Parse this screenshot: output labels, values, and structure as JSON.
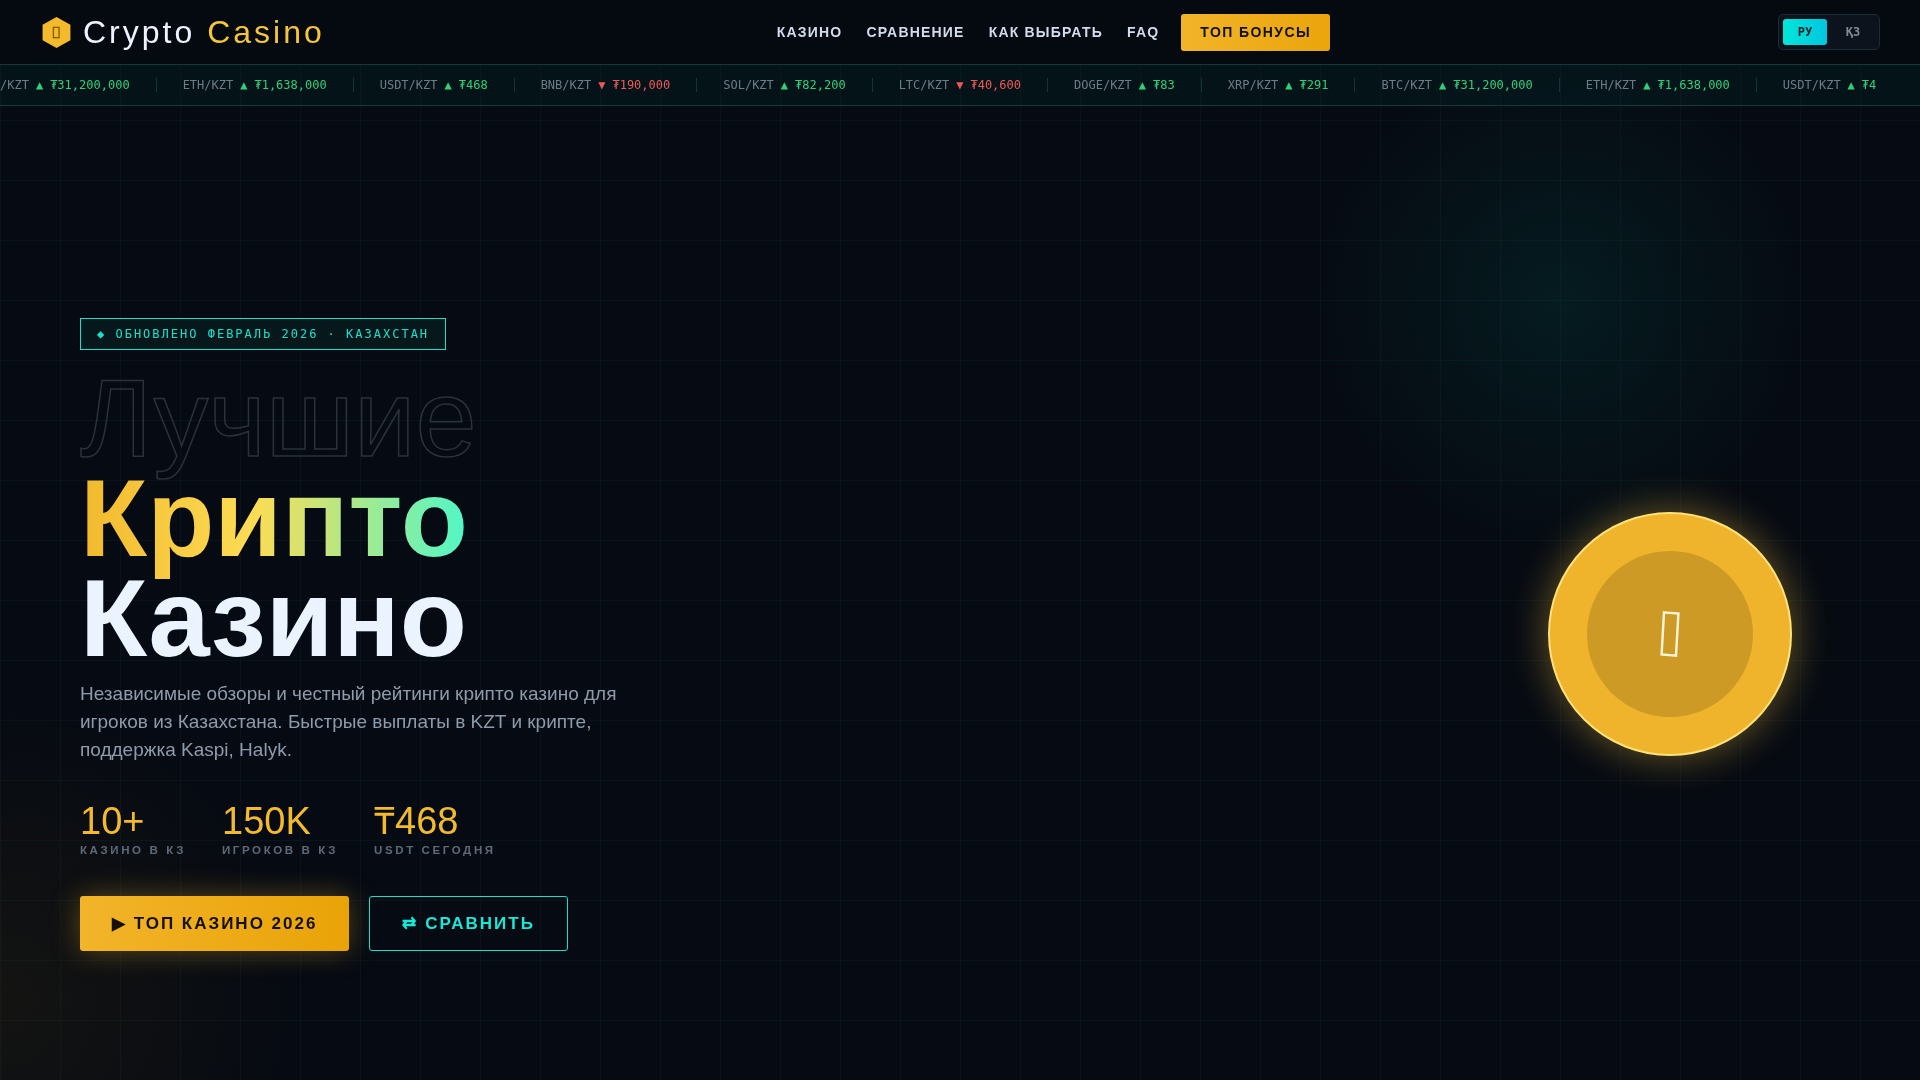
{
  "header": {
    "logo": {
      "first": "Crypto",
      "second": "Casino"
    },
    "nav": [
      {
        "label": "КАЗИНО"
      },
      {
        "label": "СРАВНЕНИЕ"
      },
      {
        "label": "КАК ВЫБРАТЬ"
      },
      {
        "label": "FAQ"
      }
    ],
    "cta": "ТОП БОНУСЫ",
    "languages": [
      {
        "label": "РУ",
        "selected": true
      },
      {
        "label": "ҚЗ",
        "selected": false
      }
    ]
  },
  "ticker": [
    {
      "pair": "/KZT",
      "arrow": "▲",
      "falling": false,
      "price": "₮31,200,000"
    },
    {
      "pair": "ETH/KZT",
      "arrow": "▲",
      "falling": false,
      "price": "₮1,638,000"
    },
    {
      "pair": "USDT/KZT",
      "arrow": "▲",
      "falling": false,
      "price": "₮468"
    },
    {
      "pair": "BNB/KZT",
      "arrow": "▼",
      "falling": true,
      "price": "₮190,000"
    },
    {
      "pair": "SOL/KZT",
      "arrow": "▲",
      "falling": false,
      "price": "₮82,200"
    },
    {
      "pair": "LTC/KZT",
      "arrow": "▼",
      "falling": true,
      "price": "₮40,600"
    },
    {
      "pair": "DOGE/KZT",
      "arrow": "▲",
      "falling": false,
      "price": "₮83"
    },
    {
      "pair": "XRP/KZT",
      "arrow": "▲",
      "falling": false,
      "price": "₮291"
    },
    {
      "pair": "BTC/KZT",
      "arrow": "▲",
      "falling": false,
      "price": "₮31,200,000"
    },
    {
      "pair": "ETH/KZT",
      "arrow": "▲",
      "falling": false,
      "price": "₮1,638,000"
    },
    {
      "pair": "USDT/KZT",
      "arrow": "▲",
      "falling": false,
      "price": "₮4"
    }
  ],
  "hero": {
    "badge": "◆ ОБНОВЛЕНО ФЕВРАЛЬ 2026 · КАЗАХСТАН",
    "title": [
      {
        "text": "Лучшие",
        "kind": "outline"
      },
      {
        "text": "Крипто",
        "kind": "gradient"
      },
      {
        "text": "Казино",
        "kind": "solid"
      }
    ],
    "description": "Независимые обзоры и честный рейтинги крипто казино для игроков из Казахстана. Быстрые выплаты в KZT и крипте, поддержка Kaspi, Halyk.",
    "stats": [
      {
        "value": "10+",
        "label": "КАЗИНО В КЗ"
      },
      {
        "value": "150K",
        "label": "ИГРОКОВ В КЗ"
      },
      {
        "value": "₸468",
        "label": "USDT СЕГОДНЯ"
      }
    ],
    "buttons": [
      {
        "label": "▶ ТОП КАЗИНО 2026",
        "kind": "primary"
      },
      {
        "label": "⇄ СРАВНИТЬ",
        "kind": "outline"
      }
    ]
  }
}
